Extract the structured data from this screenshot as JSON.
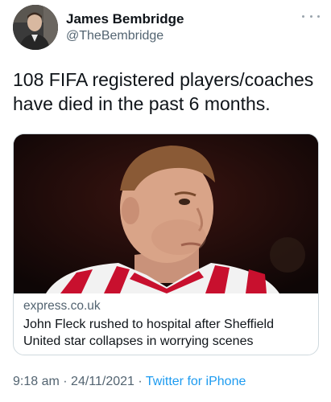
{
  "author": {
    "display_name": "James Bembridge",
    "handle": "@TheBembridge"
  },
  "tweet": {
    "text": "108 FIFA registered players/coaches have died in the past 6 months."
  },
  "card": {
    "domain": "express.co.uk",
    "title": "John Fleck rushed to hospital after Sheffield United star collapses in worrying scenes"
  },
  "footer": {
    "time": "9:18 am",
    "separator": "·",
    "date": "24/11/2021",
    "source": "Twitter for iPhone"
  },
  "colors": {
    "link": "#1d9bf0",
    "secondary_text": "#536471",
    "kit_red": "#c8102e"
  },
  "icons": {
    "more": "more-dots-icon"
  }
}
